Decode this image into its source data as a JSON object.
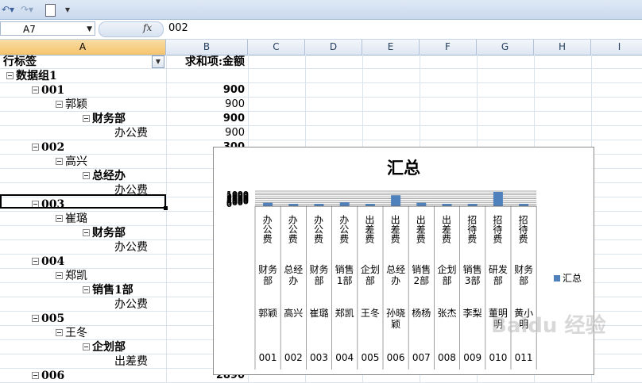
{
  "toolbar": {
    "undo_icon": "undo-icon",
    "redo_icon": "redo-icon",
    "new_icon": "new-document-icon",
    "customize": "▾"
  },
  "formula_bar": {
    "name_box": "A7",
    "fx": "fx",
    "value": "002"
  },
  "columns": [
    "A",
    "B",
    "C",
    "D",
    "E",
    "F",
    "G",
    "H",
    "I"
  ],
  "pivot": {
    "row_label_header": "行标签",
    "sum_header": "求和项:金额",
    "rows": [
      {
        "level": 0,
        "label": "数据组1",
        "value": "",
        "bold": true,
        "toggle": true
      },
      {
        "level": 1,
        "label": "001",
        "value": "900",
        "bold": true,
        "toggle": true
      },
      {
        "level": 2,
        "label": "郭颖",
        "value": "900",
        "bold": false,
        "toggle": true
      },
      {
        "level": 3,
        "label": "财务部",
        "value": "900",
        "bold": true,
        "toggle": true
      },
      {
        "level": 4,
        "label": "办公费",
        "value": "900",
        "bold": false,
        "toggle": false
      },
      {
        "level": 1,
        "label": "002",
        "value": "300",
        "bold": true,
        "toggle": true
      },
      {
        "level": 2,
        "label": "高兴",
        "value": "",
        "bold": false,
        "toggle": true
      },
      {
        "level": 3,
        "label": "总经办",
        "value": "",
        "bold": true,
        "toggle": true
      },
      {
        "level": 4,
        "label": "办公费",
        "value": "",
        "bold": false,
        "toggle": false
      },
      {
        "level": 1,
        "label": "003",
        "value": "",
        "bold": true,
        "toggle": true
      },
      {
        "level": 2,
        "label": "崔璐",
        "value": "",
        "bold": false,
        "toggle": true
      },
      {
        "level": 3,
        "label": "财务部",
        "value": "",
        "bold": true,
        "toggle": true
      },
      {
        "level": 4,
        "label": "办公费",
        "value": "",
        "bold": false,
        "toggle": false
      },
      {
        "level": 1,
        "label": "004",
        "value": "",
        "bold": true,
        "toggle": true
      },
      {
        "level": 2,
        "label": "郑凯",
        "value": "",
        "bold": false,
        "toggle": true
      },
      {
        "level": 3,
        "label": "销售1部",
        "value": "",
        "bold": true,
        "toggle": true
      },
      {
        "level": 4,
        "label": "办公费",
        "value": "",
        "bold": false,
        "toggle": false
      },
      {
        "level": 1,
        "label": "005",
        "value": "",
        "bold": true,
        "toggle": true
      },
      {
        "level": 2,
        "label": "王冬",
        "value": "",
        "bold": false,
        "toggle": true
      },
      {
        "level": 3,
        "label": "企划部",
        "value": "",
        "bold": true,
        "toggle": true
      },
      {
        "level": 4,
        "label": "出差费",
        "value": "",
        "bold": false,
        "toggle": false
      },
      {
        "level": 1,
        "label": "006",
        "value": "2890",
        "bold": true,
        "toggle": true
      }
    ]
  },
  "chart_data": {
    "type": "bar",
    "title": "汇总",
    "legend": "汇总",
    "legend_position": "right",
    "series": [
      {
        "name": "汇总",
        "values": [
          900,
          300,
          400,
          1000,
          300,
          2890,
          900,
          300,
          350,
          3800,
          600
        ]
      }
    ],
    "category_levels": {
      "expense": [
        "办公费",
        "办公费",
        "办公费",
        "办公费",
        "出差费",
        "出差费",
        "出差费",
        "出差费",
        "招待费",
        "招待费",
        "招待费"
      ],
      "department": [
        "财务部",
        "总经办",
        "财务部",
        "销售1部",
        "企划部",
        "总经办",
        "销售2部",
        "企划部",
        "销售3部",
        "研发部",
        "财务部"
      ],
      "person": [
        "郭颖",
        "高兴",
        "崔璐",
        "郑凯",
        "王冬",
        "孙晓颖",
        "杨杨",
        "张杰",
        "李梨",
        "董明明",
        "黄小明"
      ],
      "code": [
        "001",
        "002",
        "003",
        "004",
        "005",
        "006",
        "007",
        "008",
        "009",
        "010",
        "011"
      ]
    },
    "ylim": [
      0,
      4000
    ],
    "yticks_overlapping": [
      "1000",
      "1500",
      "2000",
      "2500",
      "3000",
      "3500",
      "4000",
      "500",
      "0"
    ]
  },
  "watermark": "Baidu 经验"
}
